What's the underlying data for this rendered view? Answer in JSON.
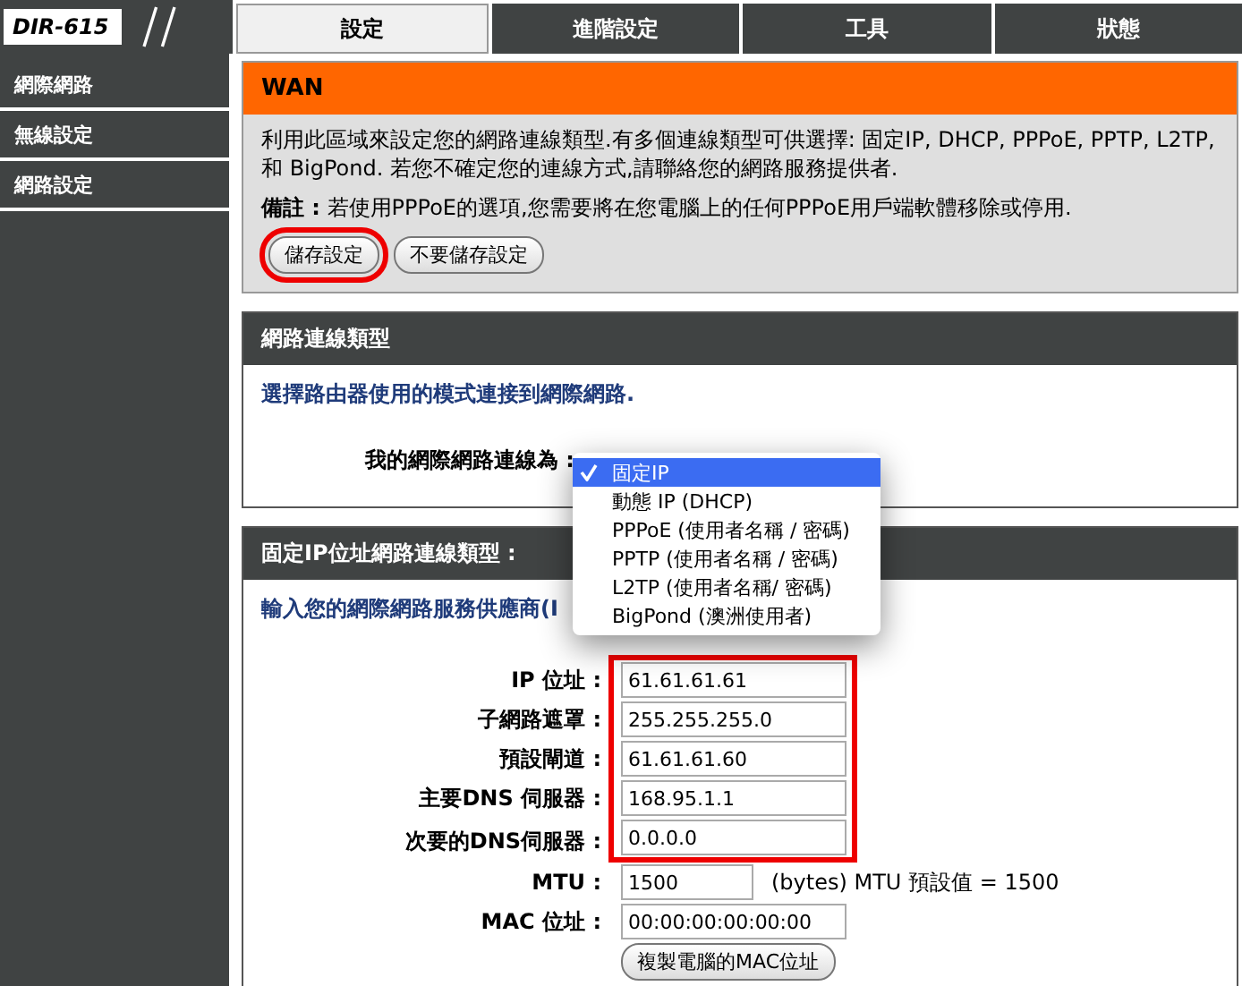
{
  "logo": "DIR-615",
  "tabs": [
    {
      "label": "設定",
      "selected": true
    },
    {
      "label": "進階設定",
      "selected": false
    },
    {
      "label": "工具",
      "selected": false
    },
    {
      "label": "狀態",
      "selected": false
    }
  ],
  "sidebar": [
    "網際網路",
    "無線設定",
    "網路設定"
  ],
  "wan": {
    "title": "WAN",
    "description": "利用此區域來設定您的網路連線類型.有多個連線類型可供選擇: 固定IP, DHCP, PPPoE, PPTP, L2TP, 和 BigPond. 若您不確定您的連線方式,請聯絡您的網路服務提供者.",
    "note": "**備註 :** 若使用PPPoE的選項,您需要將在您電腦上的任何PPPoE用戶端軟體移除或停用.",
    "buttons": [
      {
        "label": "儲存設定",
        "highlighted": true
      },
      {
        "label": "不要儲存設定",
        "highlighted": false
      }
    ]
  },
  "connection_type": {
    "title": "網路連線類型",
    "instruction": "選擇路由器使用的模式連接到網際網路.",
    "field_label": "我的網際網路連線為 :",
    "options": [
      {
        "label": "固定IP",
        "selected": true
      },
      {
        "label": "動態 IP (DHCP)",
        "selected": false
      },
      {
        "label": "PPPoE (使用者名稱 / 密碼)",
        "selected": false
      },
      {
        "label": "PPTP (使用者名稱 / 密碼)",
        "selected": false
      },
      {
        "label": "L2TP (使用者名稱/ 密碼)",
        "selected": false
      },
      {
        "label": "BigPond (澳洲使用者)",
        "selected": false
      }
    ]
  },
  "static_ip": {
    "title": "固定IP位址網路連線類型 :",
    "instruction": "輸入您的網際網路服務供應商(I",
    "fields": [
      {
        "label": "IP 位址 :",
        "value": "61.61.61.61",
        "highlighted": true
      },
      {
        "label": "子網路遮罩 :",
        "value": "255.255.255.0",
        "highlighted": true
      },
      {
        "label": "預設閘道 :",
        "value": "61.61.61.60",
        "highlighted": true
      },
      {
        "label": "主要DNS 伺服器 :",
        "value": "168.95.1.1",
        "highlighted": true
      },
      {
        "label": "次要的DNS伺服器 :",
        "value": "0.0.0.0",
        "highlighted": true
      },
      {
        "label": "MTU :",
        "value": "1500",
        "highlighted": false,
        "note": "(bytes) MTU 預設值 = 1500"
      },
      {
        "label": "MAC 位址 :",
        "value": "00:00:00:00:00:00",
        "highlighted": false
      }
    ],
    "clone_button": "複製電腦的MAC位址"
  }
}
